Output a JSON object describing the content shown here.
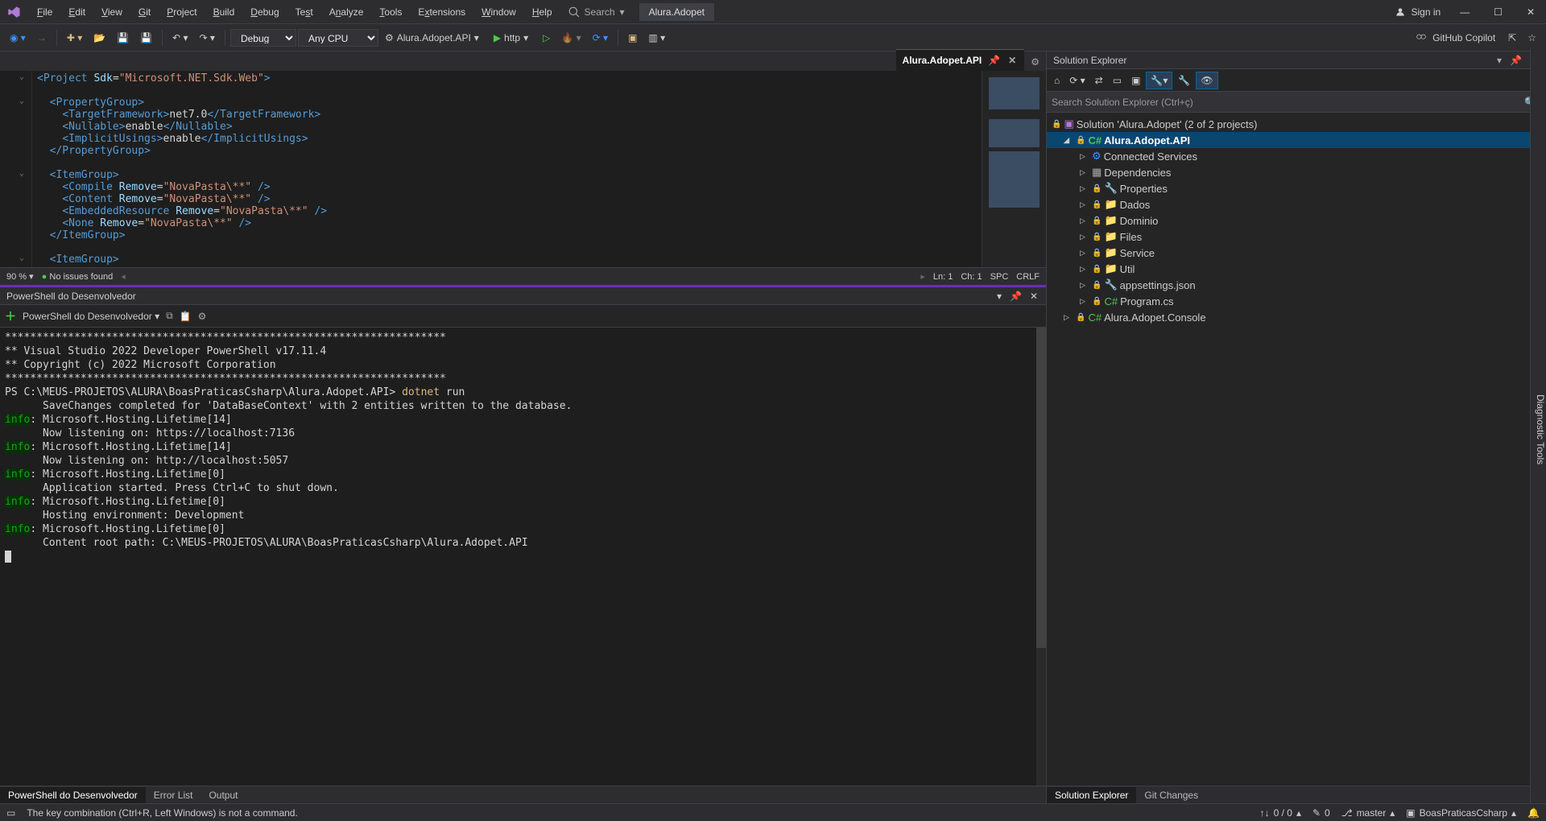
{
  "menu": {
    "items": [
      "File",
      "Edit",
      "View",
      "Git",
      "Project",
      "Build",
      "Debug",
      "Test",
      "Analyze",
      "Tools",
      "Extensions",
      "Window",
      "Help"
    ],
    "search": "Search",
    "title": "Alura.Adopet",
    "signin": "Sign in"
  },
  "tool": {
    "config": "Debug",
    "platform": "Any CPU",
    "startup": "Alura.Adopet.API",
    "launch": "http",
    "copilot": "GitHub Copilot"
  },
  "editor": {
    "tab": "Alura.Adopet.API",
    "zoom": "90 %",
    "issues": "No issues found",
    "ln": "Ln: 1",
    "ch": "Ch: 1",
    "spc": "SPC",
    "crlf": "CRLF",
    "code": {
      "l0": "<Project Sdk=\"Microsoft.NET.Sdk.Web\">",
      "l1": "  <PropertyGroup>",
      "l2": "    <TargetFramework>net7.0</TargetFramework>",
      "l3": "    <Nullable>enable</Nullable>",
      "l4": "    <ImplicitUsings>enable</ImplicitUsings>",
      "l5": "  </PropertyGroup>",
      "l6": "  <ItemGroup>",
      "l7": "    <Compile Remove=\"NovaPasta\\**\" />",
      "l8": "    <Content Remove=\"NovaPasta\\**\" />",
      "l9": "    <EmbeddedResource Remove=\"NovaPasta\\**\" />",
      "l10": "    <None Remove=\"NovaPasta\\**\" />",
      "l11": "  </ItemGroup>",
      "l12": "  <ItemGroup>"
    }
  },
  "terminal": {
    "title": "PowerShell do Desenvolvedor",
    "session": "PowerShell do Desenvolvedor",
    "lines": [
      "**********************************************************************",
      "** Visual Studio 2022 Developer PowerShell v17.11.4",
      "** Copyright (c) 2022 Microsoft Corporation",
      "**********************************************************************"
    ],
    "prompt": "PS C:\\MEUS-PROJETOS\\ALURA\\BoasPraticasCsharp\\Alura.Adopet.API> ",
    "cmd": "dotnet",
    "cmd2": " run",
    "save": "      SaveChanges completed for 'DataBaseContext' with 2 entities written to the database.",
    "entries": [
      {
        "p": "info",
        "s": ": Microsoft.Hosting.Lifetime[14]",
        "l2": "      Now listening on: https://localhost:7136"
      },
      {
        "p": "info",
        "s": ": Microsoft.Hosting.Lifetime[14]",
        "l2": "      Now listening on: http://localhost:5057"
      },
      {
        "p": "info",
        "s": ": Microsoft.Hosting.Lifetime[0]",
        "l2": "      Application started. Press Ctrl+C to shut down."
      },
      {
        "p": "info",
        "s": ": Microsoft.Hosting.Lifetime[0]",
        "l2": "      Hosting environment: Development"
      },
      {
        "p": "info",
        "s": ": Microsoft.Hosting.Lifetime[0]",
        "l2": "      Content root path: C:\\MEUS-PROJETOS\\ALURA\\BoasPraticasCsharp\\Alura.Adopet.API"
      }
    ],
    "tabs": [
      "PowerShell do Desenvolvedor",
      "Error List",
      "Output"
    ]
  },
  "sol": {
    "title": "Solution Explorer",
    "search": "Search Solution Explorer (Ctrl+ç)",
    "root": "Solution 'Alura.Adopet' (2 of 2 projects)",
    "proj": "Alura.Adopet.API",
    "nodes": [
      "Connected Services",
      "Dependencies",
      "Properties",
      "Dados",
      "Dominio",
      "Files",
      "Service",
      "Util",
      "appsettings.json",
      "Program.cs"
    ],
    "proj2": "Alura.Adopet.Console",
    "tabs": [
      "Solution Explorer",
      "Git Changes"
    ]
  },
  "siderail": "Diagnostic Tools",
  "status": {
    "msg": "The key combination (Ctrl+R, Left Windows) is not a command.",
    "updown": "0 / 0",
    "edit": "0",
    "branch": "master",
    "repo": "BoasPraticasCsharp"
  }
}
